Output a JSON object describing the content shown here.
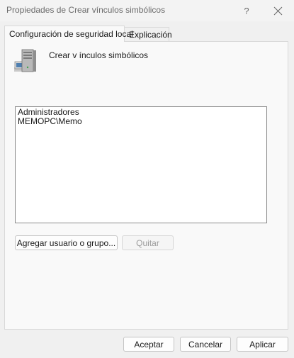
{
  "window": {
    "title": "Propiedades de Crear vínculos simbólicos",
    "help_glyph": "?",
    "close_icon": "close-icon"
  },
  "tabs": [
    {
      "label": "Configuración de seguridad local",
      "active": true
    },
    {
      "label": "Explicación",
      "active": false
    }
  ],
  "policy": {
    "icon": "server-computer-icon",
    "name": "Crear v ínculos simbólicos"
  },
  "members": [
    "Administradores",
    "MEMOPC\\Memo"
  ],
  "actions": {
    "add_label": "Agregar usuario o grupo...",
    "remove_label": "Quitar",
    "remove_enabled": false
  },
  "footer": {
    "ok_label": "Aceptar",
    "cancel_label": "Cancelar",
    "apply_label": "Aplicar"
  },
  "colors": {
    "background": "#f0f0f0",
    "panel": "#f9f9f9",
    "disabled_text": "#9c9c9c"
  }
}
